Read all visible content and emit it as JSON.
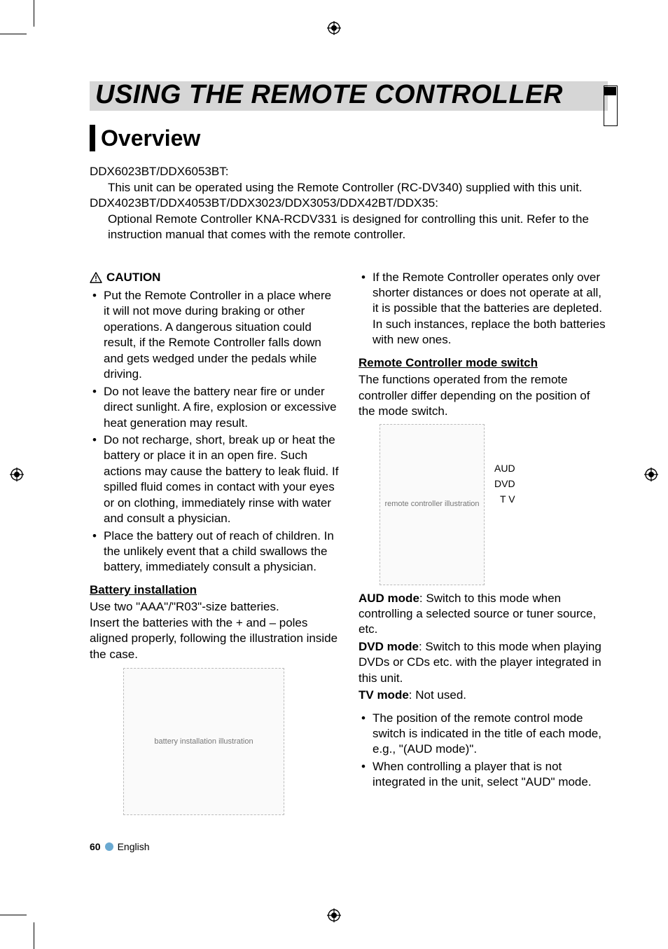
{
  "title": "USING THE REMOTE CONTROLLER",
  "section": "Overview",
  "intro": {
    "models1": "DDX6023BT/DDX6053BT:",
    "desc1": "This unit can be operated using the Remote Controller (RC-DV340) supplied with this unit.",
    "models2": "DDX4023BT/DDX4053BT/DDX3023/DDX3053/DDX42BT/DDX35:",
    "desc2": "Optional Remote Controller KNA-RCDV331 is designed for controlling this unit. Refer to the instruction manual that comes with the remote controller."
  },
  "caution": {
    "label": "CAUTION",
    "items": [
      "Put the Remote Controller in a place where it will not move during braking or other operations. A dangerous situation could result, if the Remote Controller falls down and gets wedged under the pedals while driving.",
      "Do not leave the battery near fire or under direct sunlight. A fire, explosion or excessive heat generation may result.",
      "Do not recharge, short, break up or heat the battery or place it in an open fire. Such actions may cause the battery to leak fluid. If spilled fluid comes in contact with your eyes or on clothing, immediately rinse with water and consult a physician.",
      "Place the battery out of reach of children. In the unlikely event that a child swallows the battery, immediately consult a physician."
    ]
  },
  "battery": {
    "heading": "Battery installation",
    "line1": "Use two \"AAA\"/\"R03\"-size batteries.",
    "line2": "Insert the batteries with the + and – poles aligned properly, following the illustration inside the case."
  },
  "right_top_bullet": "If the Remote Controller operates only over shorter distances or does not operate at all, it is possible that the batteries are depleted. In such instances, replace the both batteries with new ones.",
  "mode_switch": {
    "heading": "Remote Controller mode switch",
    "intro": "The functions operated from the remote controller differ depending on the position of the mode switch.",
    "labels": {
      "aud": "AUD",
      "dvd": "DVD",
      "tv": "T V"
    },
    "aud_label": "AUD mode",
    "aud_text": ": Switch to this mode when controlling a selected source or tuner source, etc.",
    "dvd_label": "DVD mode",
    "dvd_text": ": Switch to this mode when playing DVDs or CDs etc. with the player integrated in this unit.",
    "tv_label": "TV mode",
    "tv_text": ": Not used.",
    "notes": [
      "The position of the remote control mode switch is indicated in the title of each mode, e.g., \"(AUD mode)\".",
      "When controlling a player that is not integrated in the unit, select \"AUD\" mode."
    ]
  },
  "figure": {
    "battery_alt": "battery installation illustration",
    "remote_alt": "remote controller illustration"
  },
  "footer": {
    "page": "60",
    "lang": "English"
  }
}
